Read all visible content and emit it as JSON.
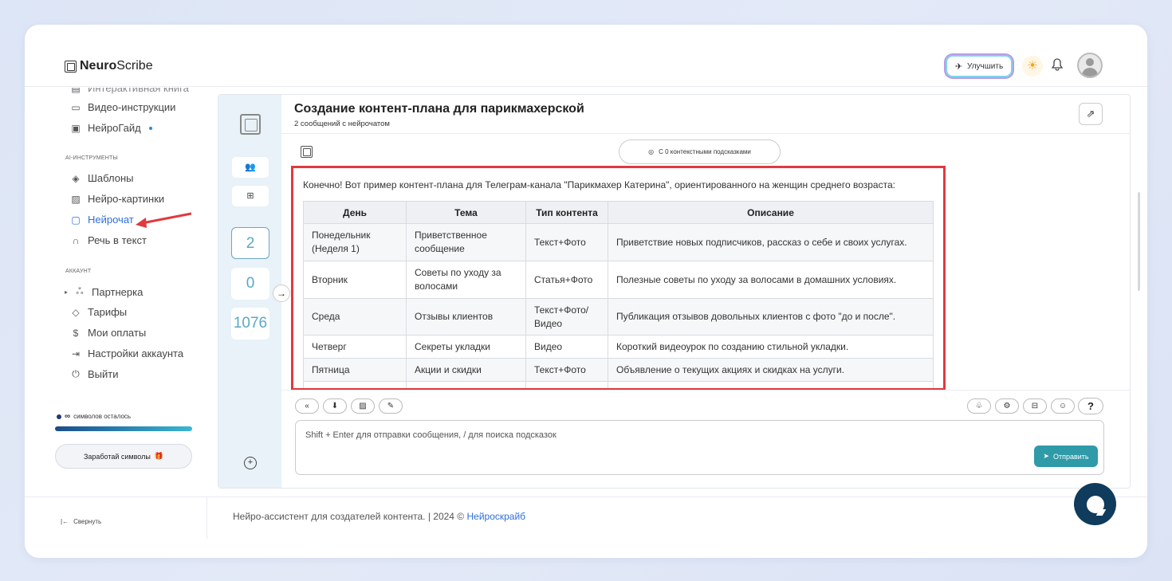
{
  "app": {
    "logo_bold": "Neuro",
    "logo_light": "Scribe"
  },
  "topbar": {
    "upgrade_label": "Улучшить"
  },
  "sidebar": {
    "cut_item": "Интерактивная книга",
    "top_items": [
      {
        "label": "Видео-инструкции",
        "icon": "video-icon"
      },
      {
        "label": "НейроГайд",
        "icon": "book-icon"
      }
    ],
    "section_ai": "AI-ИНСТРУМЕНТЫ",
    "ai_items": [
      {
        "label": "Шаблоны",
        "icon": "layers-icon"
      },
      {
        "label": "Нейро-картинки",
        "icon": "image-icon"
      },
      {
        "label": "Нейрочат",
        "icon": "chat-icon"
      },
      {
        "label": "Речь в текст",
        "icon": "headphones-icon"
      }
    ],
    "section_account": "АККАУНТ",
    "account_items": [
      {
        "label": "Партнерка",
        "icon": "users-icon"
      },
      {
        "label": "Тарифы",
        "icon": "tag-icon"
      },
      {
        "label": "Мои оплаты",
        "icon": "dollar-icon"
      },
      {
        "label": "Настройки аккаунта",
        "icon": "login-icon"
      },
      {
        "label": "Выйти",
        "icon": "power-icon"
      }
    ],
    "symbols_left_sign": "∞",
    "symbols_left": "символов осталось",
    "earn_label": "Заработай символы",
    "collapse_label": "Свернуть"
  },
  "counters": {
    "c1": "2",
    "c2": "0",
    "c3": "1076"
  },
  "chat": {
    "title": "Создание контент-плана для парикмахерской",
    "subtitle": "2 сообщений с нейрочатом",
    "context_pill": "С 0 контекстными подсказками",
    "intro": "Конечно! Вот пример контент-плана для Телеграм-канала \"Парикмахер Катерина\", ориентированного на женщин среднего возраста:",
    "table": {
      "headers": [
        "День",
        "Тема",
        "Тип контента",
        "Описание"
      ],
      "rows": [
        [
          "Понедельник (Неделя 1)",
          "Приветственное сообщение",
          "Текст+Фото",
          "Приветствие новых подписчиков, рассказ о себе и своих услугах."
        ],
        [
          "Вторник",
          "Советы по уходу за волосами",
          "Статья+Фото",
          "Полезные советы по уходу за волосами в домашних условиях."
        ],
        [
          "Среда",
          "Отзывы клиентов",
          "Текст+Фото/ Видео",
          "Публикация отзывов довольных клиентов с фото \"до и после\"."
        ],
        [
          "Четверг",
          "Секреты укладки",
          "Видео",
          "Короткий видеоурок по созданию стильной укладки."
        ],
        [
          "Пятница",
          "Акции и скидки",
          "Текст+Фото",
          "Объявление о текущих акциях и скидках на услуги."
        ]
      ]
    },
    "input_placeholder": "Shift + Enter для отправки сообщения, / для поиска подсказок",
    "send_label": "Отправить"
  },
  "footer": {
    "text": "Нейро-ассистент для создателей контента.  | 2024 ©",
    "link": "Нейроскрайб"
  }
}
